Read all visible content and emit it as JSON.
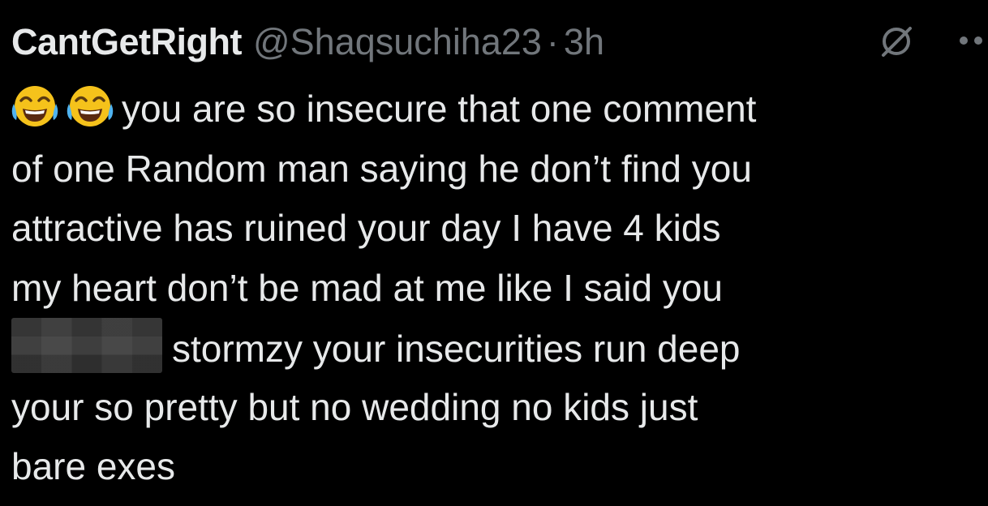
{
  "tweet": {
    "display_name": "CantGetRight",
    "handle": "@Shaqsuchiha23",
    "separator": "·",
    "timestamp": "3h",
    "icons": {
      "emoji": "face-with-tears-of-joy-emoji",
      "grok": "grok-icon",
      "more": "more-options-icon"
    },
    "lines": [
      "you are so insecure that one comment",
      "of one Random man saying he don’t find you",
      "attractive has ruined your day I have 4 kids",
      "my heart don’t be mad at me like I said you",
      "stormzy your insecurities run deep",
      "your so pretty but no wedding no kids just",
      "bare exes"
    ]
  },
  "colors": {
    "background": "#000000",
    "primary_text": "#e7e9ea",
    "secondary_text": "#71767b"
  }
}
